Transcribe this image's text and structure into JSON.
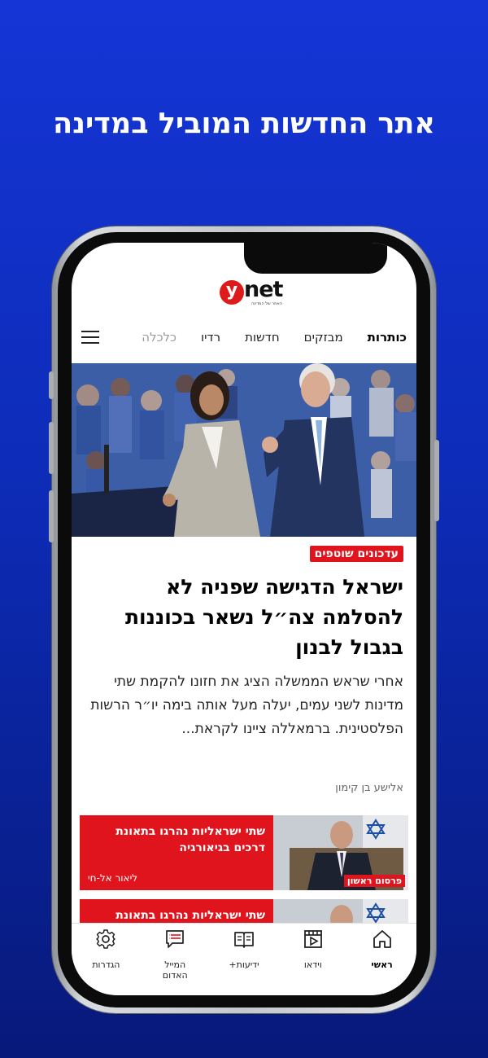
{
  "promo": {
    "title": "אתר החדשות המוביל במדינה"
  },
  "brand": {
    "logo_letter": "y",
    "logo_text": "net",
    "tagline": "האתר של המדינה"
  },
  "nav": {
    "items": [
      {
        "label": "כותרות",
        "active": true
      },
      {
        "label": "מבזקים"
      },
      {
        "label": "חדשות"
      },
      {
        "label": "רדיו"
      },
      {
        "label": "כלכלה",
        "faded": true
      }
    ]
  },
  "hero": {
    "badge": "עדכונים שוטפים",
    "headline": "ישראל הדגישה שפניה לא להסלמה צה״ל נשאר בכוננות בגבול לבנון",
    "summary": "אחרי שראש הממשלה הציג את חזונו להקמת שתי מדינות לשני עמים, יעלה מעל אותה בימה יו״ר הרשות הפלסטינית. ברמאללה ציינו לקראת...",
    "author": "אלישע בן קימון"
  },
  "cards": [
    {
      "title": "שתי ישראליות נהרגו בתאונת דרכים בגיאורגיה",
      "author": "ליאור אל-חי",
      "image_badge": "פרסום ראשון"
    },
    {
      "title": "שתי ישראליות נהרגו בתאונת",
      "author": "",
      "image_badge": ""
    }
  ],
  "tabbar": {
    "items": [
      {
        "label": "ראשי",
        "icon": "home-icon",
        "active": true
      },
      {
        "label": "וידאו",
        "icon": "video-icon"
      },
      {
        "label": "ידיעות+",
        "icon": "book-icon"
      },
      {
        "label": "המייל האדום",
        "icon": "message-icon"
      },
      {
        "label": "הגדרות",
        "icon": "gear-icon"
      }
    ]
  },
  "colors": {
    "accent": "#e0141c",
    "background": "#1535d6"
  }
}
